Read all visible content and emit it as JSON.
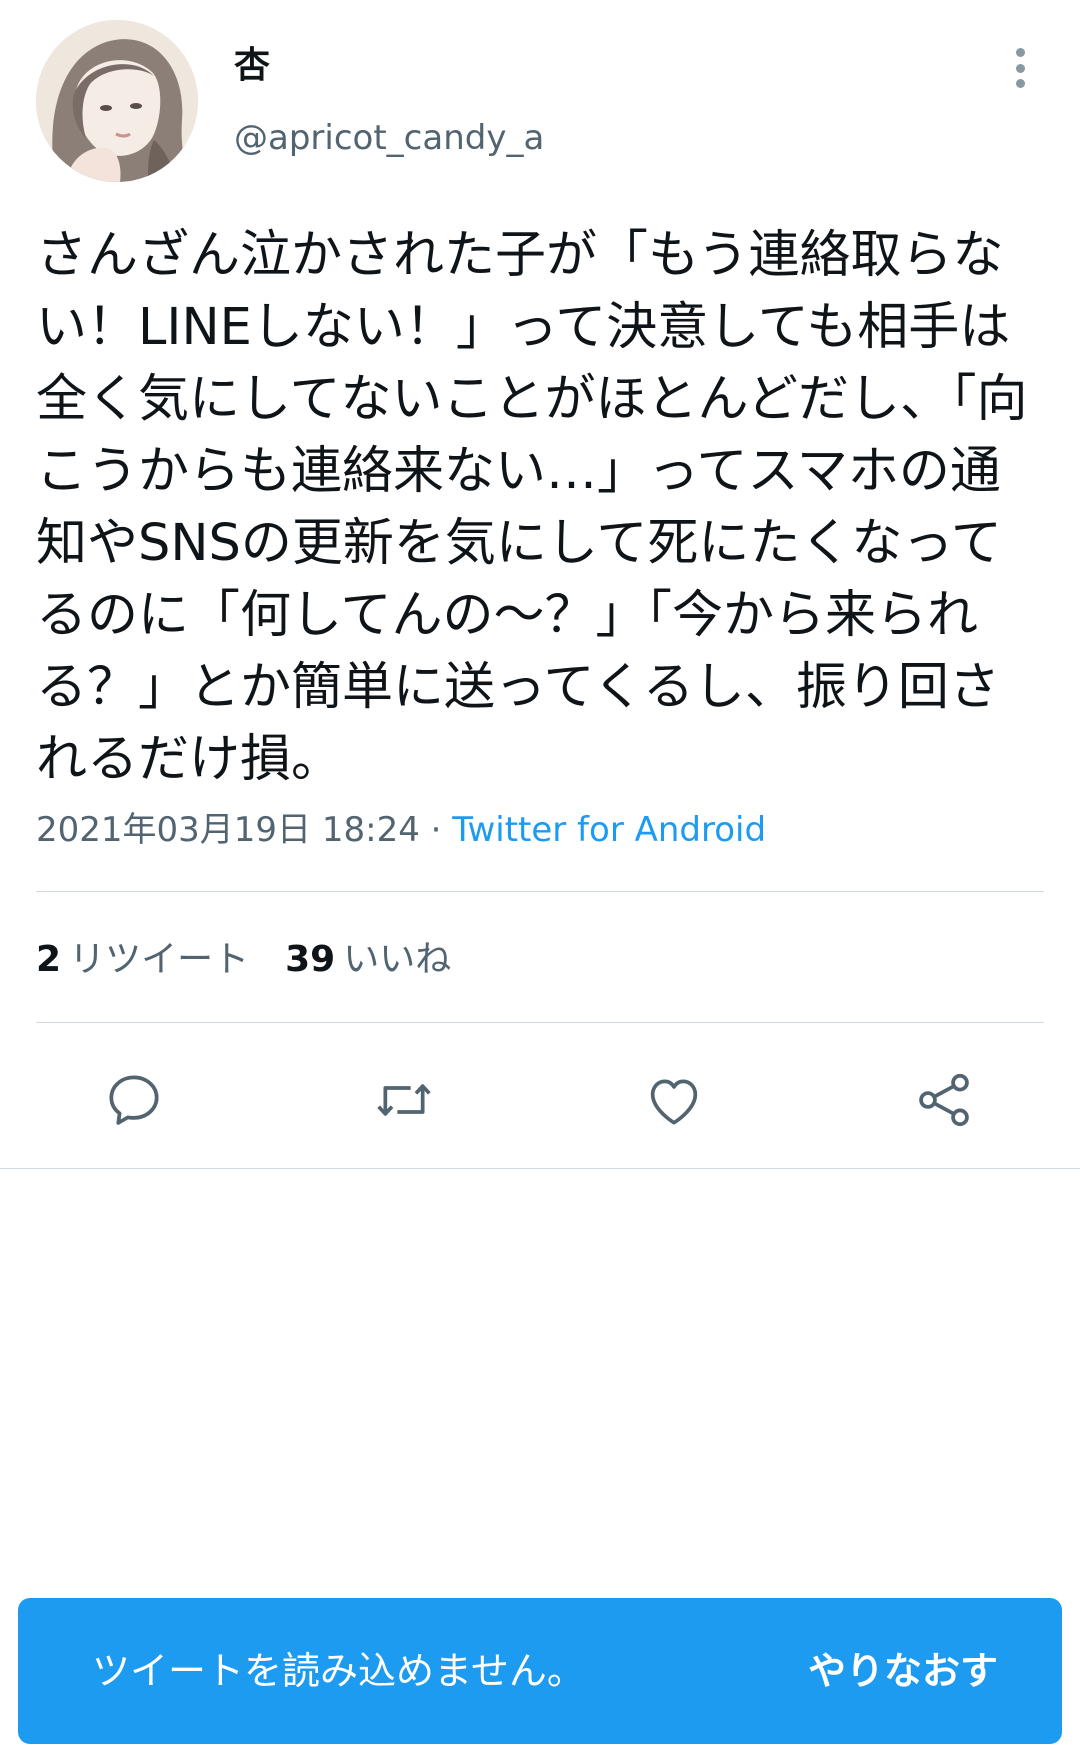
{
  "author": {
    "name": "杏",
    "handle": "@apricot_candy_a"
  },
  "tweet": {
    "text": "さんざん泣かされた子が「もう連絡取らない！LINEしない！」って決意しても相手は全く気にしてないことがほとんどだし、「向こうからも連絡来ない…」ってスマホの通知やSNSの更新を気にして死にたくなってるのに「何してんの〜？」「今から来られる？」とか簡単に送ってくるし、振り回されるだけ損。",
    "timestamp": "2021年03月19日 18:24",
    "separator": "·",
    "source": "Twitter for Android"
  },
  "stats": {
    "retweets_count": "2",
    "retweets_label": "リツイート",
    "likes_count": "39",
    "likes_label": "いいね"
  },
  "actions": [
    "reply-icon",
    "retweet-icon",
    "like-icon",
    "share-icon"
  ],
  "colors": {
    "accent": "#1d9bf0",
    "secondary_text": "#536471",
    "icon": "#536471",
    "divider": "#cfd9de"
  },
  "snackbar": {
    "message": "ツイートを読み込めません。",
    "action_label": "やりなおす"
  }
}
